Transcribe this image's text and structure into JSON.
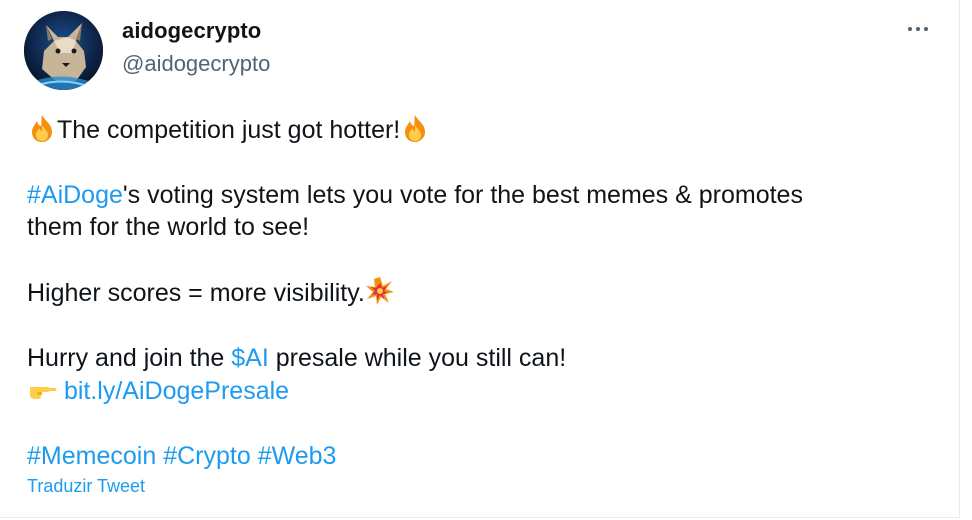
{
  "tweet": {
    "author": {
      "name": "aidogecrypto",
      "handle": "@aidogecrypto",
      "avatar_icon": "dog-avatar-icon"
    },
    "more_icon": "more-options-icon",
    "lines": {
      "l1_text": "The competition just got hotter!",
      "l2_hashtag": "#AiDoge",
      "l2_text": "'s voting system lets you vote for the best memes & promotes",
      "l3_text": "them for the world to see!",
      "l4_text": "Higher scores = more visibility.",
      "l5_text_a": "Hurry and join the ",
      "l5_cashtag": "$AI",
      "l5_text_b": " presale while you still can!",
      "l6_link": "bit.ly/AiDogePresale",
      "hashtags": [
        "#Memecoin",
        "#Crypto",
        "#Web3"
      ]
    },
    "translate_label": "Traduzir Tweet"
  },
  "colors": {
    "link": "#1d9bf0",
    "text": "#0f1419",
    "muted": "#536471"
  }
}
